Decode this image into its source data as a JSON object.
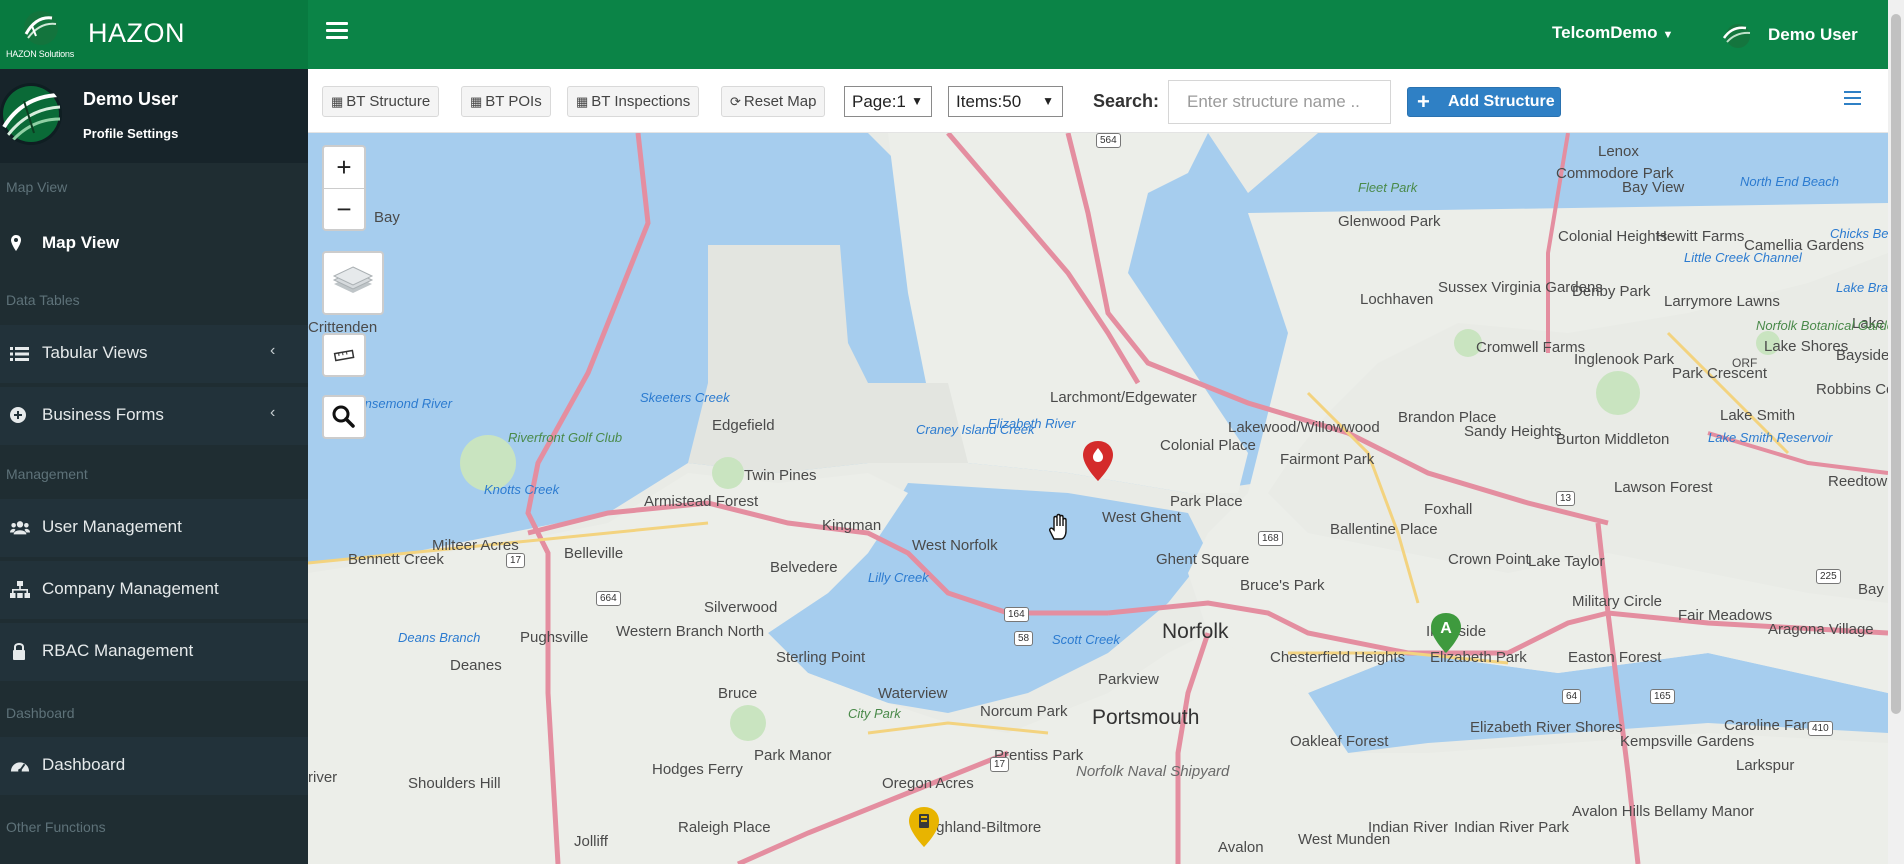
{
  "brand": {
    "name": "HAZON",
    "tagline": "HAZON Solutions"
  },
  "header": {
    "tenant": "TelcomDemo",
    "user": "Demo User"
  },
  "profile": {
    "name": "Demo User",
    "settings": "Profile Settings"
  },
  "sidebar": {
    "sections": [
      "Map View",
      "Data Tables",
      "Management",
      "Dashboard",
      "Other Functions"
    ],
    "items": [
      {
        "label": "Map View",
        "icon": "map-pin-icon",
        "active": true
      },
      {
        "label": "Tabular Views",
        "icon": "list-icon",
        "has_submenu": true
      },
      {
        "label": "Business Forms",
        "icon": "plus-circle-icon",
        "has_submenu": true
      },
      {
        "label": "User Management",
        "icon": "users-icon"
      },
      {
        "label": "Company Management",
        "icon": "sitemap-icon"
      },
      {
        "label": "RBAC Management",
        "icon": "lock-icon"
      },
      {
        "label": "Dashboard",
        "icon": "dashboard-icon"
      }
    ]
  },
  "toolbar": {
    "bt_structure": "BT Structure",
    "bt_pois": "BT POIs",
    "bt_inspections": "BT Inspections",
    "reset_map": "Reset Map",
    "page_select": "Page:1",
    "items_select": "Items:50",
    "search_label": "Search:",
    "search_placeholder": "Enter structure name ..",
    "add_structure": "Add Structure"
  },
  "map": {
    "controls": {
      "zoom_in": "+",
      "zoom_out": "−"
    },
    "labels": [
      "Lenox",
      "Commodore Park",
      "North End Beach",
      "Bay View",
      "Fleet Park",
      "Glenwood Park",
      "Colonial Heights",
      "Hewitt Farms",
      "Camellia Gardens",
      "Chicks Beach",
      "Little Creek Channel",
      "Lake Bradford",
      "Lake Joyce",
      "Bay",
      "Lochhaven",
      "Sussex Virginia Gardens",
      "Denby Park",
      "Larrymore Lawns",
      "Norfolk Botanical Garden",
      "Lake Shores",
      "Bayside",
      "Crittenden",
      "Cromwell Farms",
      "Inglenook Park",
      "Park Crescent",
      "ORF",
      "Robbins Corner",
      "Skeeters Creek",
      "Larchmont/Edgewater",
      "Lake Smith",
      "Nansemond River",
      "Riverfront Golf Club",
      "Edgefield",
      "Craney Island Creek",
      "Elizabeth River",
      "Lakewood/Willowwood",
      "Brandon Place",
      "Sandy Heights",
      "Burton Middleton",
      "Lake Smith Reservoir",
      "Colonial Place",
      "Fairmont Park",
      "Twin Pines",
      "Knotts Creek",
      "Lawson Forest",
      "Reedtown",
      "Armistead Forest",
      "Kingman",
      "Park Place",
      "Foxhall",
      "West Ghent",
      "Ballentine Place",
      "Milteer Acres",
      "Bennett Creek",
      "Belleville",
      "West Norfolk",
      "Belvedere",
      "Ghent Square",
      "Crown Point",
      "Lake Taylor",
      "Lilly Creek",
      "Bruce's Park",
      "Military Circle",
      "Silverwood",
      "Ingleside",
      "Fair Meadows",
      "Aragona Village",
      "Pughsville",
      "Western Branch North",
      "Sterling Point",
      "Scott Creek",
      "Norfolk",
      "Chesterfield Heights",
      "Elizabeth Park",
      "Easton Forest",
      "Deans Branch",
      "Deanes",
      "Bruce",
      "Parkview",
      "Waterview",
      "Norcum Park",
      "Portsmouth",
      "Caroline Farms",
      "Elizabeth River Shores",
      "Kempsville Gardens",
      "Larkspur",
      "City Park",
      "Oakleaf Forest",
      "Park Manor",
      "Prentiss Park",
      "Hodges Ferry",
      "Shoulders Hill",
      "Oregon Acres",
      "Norfolk Naval Shipyard",
      "Bellamy Manor",
      "Raleigh Place",
      "Highland-Biltmore",
      "Indian River",
      "Indian River Park",
      "Avalon Hills",
      "Jolliff",
      "Avalon",
      "West Munden",
      "Bay",
      "river"
    ],
    "route_shields": [
      "564",
      "168",
      "13",
      "17",
      "664",
      "164",
      "58",
      "17",
      "165",
      "64",
      "225",
      "410"
    ]
  },
  "colors": {
    "header_green": "#0b8447",
    "sidebar_bg": "#1f2d32",
    "accent_blue": "#2f80c5",
    "marker_red": "#d42b2b",
    "marker_green": "#3e9a3e",
    "marker_yellow": "#e8b400"
  }
}
